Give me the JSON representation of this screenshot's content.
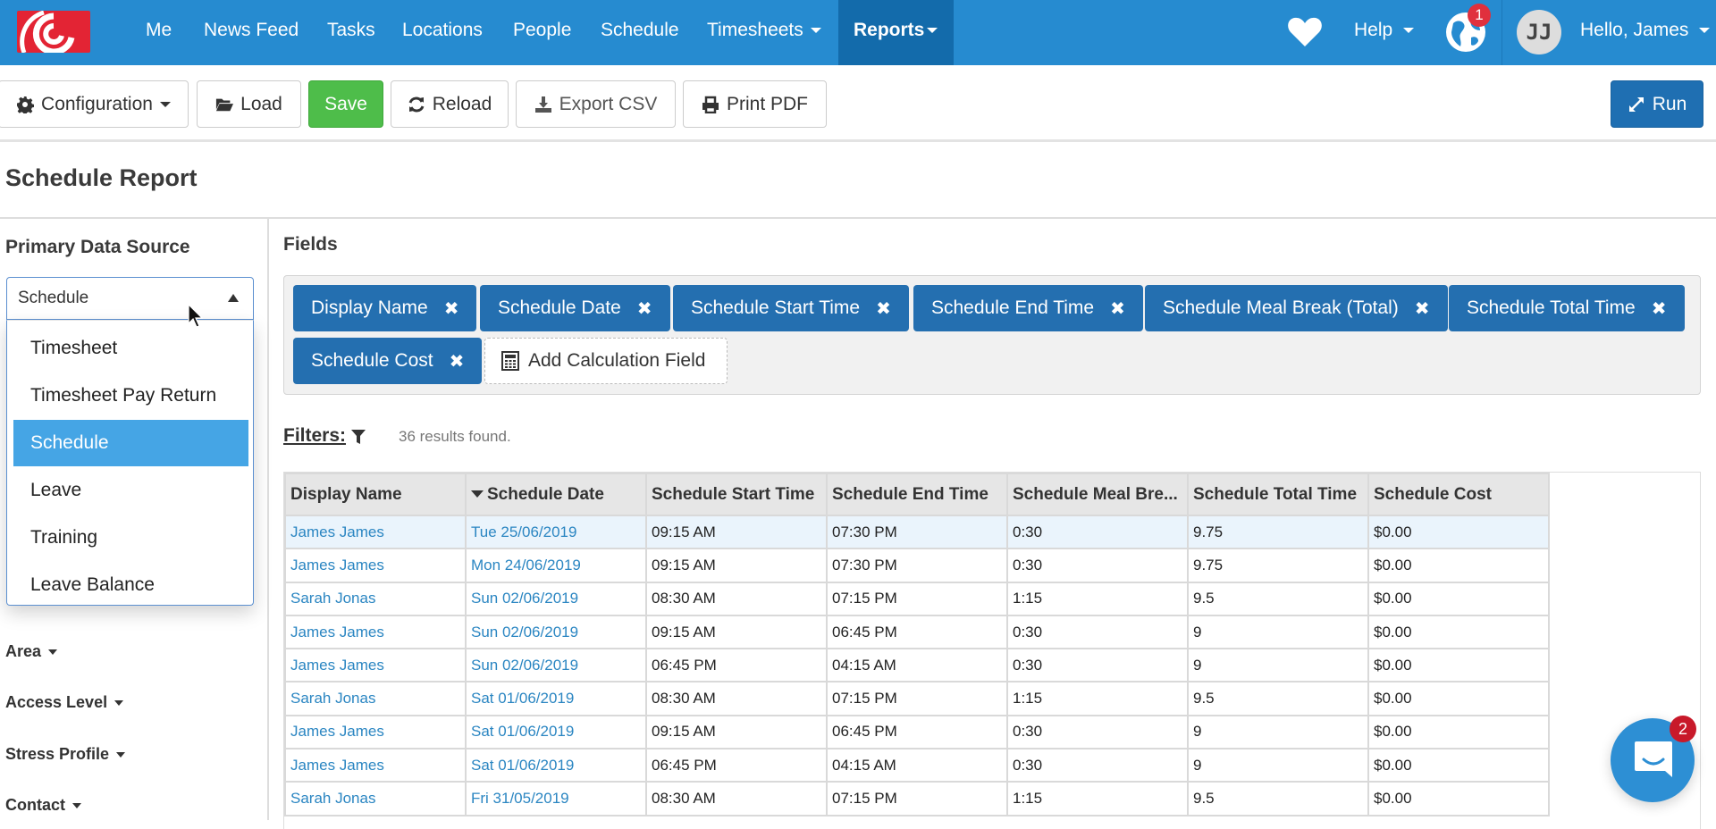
{
  "nav": {
    "items": [
      {
        "label": "Me"
      },
      {
        "label": "News Feed"
      },
      {
        "label": "Tasks"
      },
      {
        "label": "Locations"
      },
      {
        "label": "People"
      },
      {
        "label": "Schedule"
      },
      {
        "label": "Timesheets"
      },
      {
        "label": "Reports"
      }
    ],
    "help_label": "Help",
    "notification_count": "1",
    "avatar_initials": "JJ",
    "greeting": "Hello, James",
    "brand_color": "#268bd0"
  },
  "toolbar": {
    "configuration_label": "Configuration",
    "load_label": "Load",
    "save_label": "Save",
    "reload_label": "Reload",
    "export_label": "Export CSV",
    "print_label": "Print PDF",
    "run_label": "Run"
  },
  "page": {
    "title": "Schedule Report"
  },
  "left_panel": {
    "data_source_label": "Primary Data Source",
    "selected_source": "Schedule",
    "source_options": [
      "Timesheet",
      "Timesheet Pay Return",
      "Schedule",
      "Leave",
      "Training",
      "Leave Balance"
    ],
    "filter_groups": [
      "Area",
      "Access Level",
      "Stress Profile",
      "Contact"
    ]
  },
  "fields": {
    "label": "Fields",
    "chips": [
      "Display Name",
      "Schedule Date",
      "Schedule Start Time",
      "Schedule End Time",
      "Schedule Meal Break (Total)",
      "Schedule Total Time",
      "Schedule Cost"
    ],
    "add_calc_label": "Add Calculation Field"
  },
  "filters": {
    "label": "Filters:",
    "results_text": "36 results found."
  },
  "table": {
    "columns": [
      "Display Name",
      "Schedule Date",
      "Schedule Start Time",
      "Schedule End Time",
      "Schedule Meal Bre...",
      "Schedule Total Time",
      "Schedule Cost"
    ],
    "sorted_column": "Schedule Date",
    "rows": [
      [
        "James James",
        "Tue 25/06/2019",
        "09:15 AM",
        "07:30 PM",
        "0:30",
        "9.75",
        "$0.00"
      ],
      [
        "James James",
        "Mon 24/06/2019",
        "09:15 AM",
        "07:30 PM",
        "0:30",
        "9.75",
        "$0.00"
      ],
      [
        "Sarah Jonas",
        "Sun 02/06/2019",
        "08:30 AM",
        "07:15 PM",
        "1:15",
        "9.5",
        "$0.00"
      ],
      [
        "James James",
        "Sun 02/06/2019",
        "09:15 AM",
        "06:45 PM",
        "0:30",
        "9",
        "$0.00"
      ],
      [
        "James James",
        "Sun 02/06/2019",
        "06:45 PM",
        "04:15 AM",
        "0:30",
        "9",
        "$0.00"
      ],
      [
        "Sarah Jonas",
        "Sat 01/06/2019",
        "08:30 AM",
        "07:15 PM",
        "1:15",
        "9.5",
        "$0.00"
      ],
      [
        "James James",
        "Sat 01/06/2019",
        "09:15 AM",
        "06:45 PM",
        "0:30",
        "9",
        "$0.00"
      ],
      [
        "James James",
        "Sat 01/06/2019",
        "06:45 PM",
        "04:15 AM",
        "0:30",
        "9",
        "$0.00"
      ],
      [
        "Sarah Jonas",
        "Fri 31/05/2019",
        "08:30 AM",
        "07:15 PM",
        "1:15",
        "9.5",
        "$0.00"
      ]
    ]
  },
  "chat": {
    "badge_count": "2"
  }
}
